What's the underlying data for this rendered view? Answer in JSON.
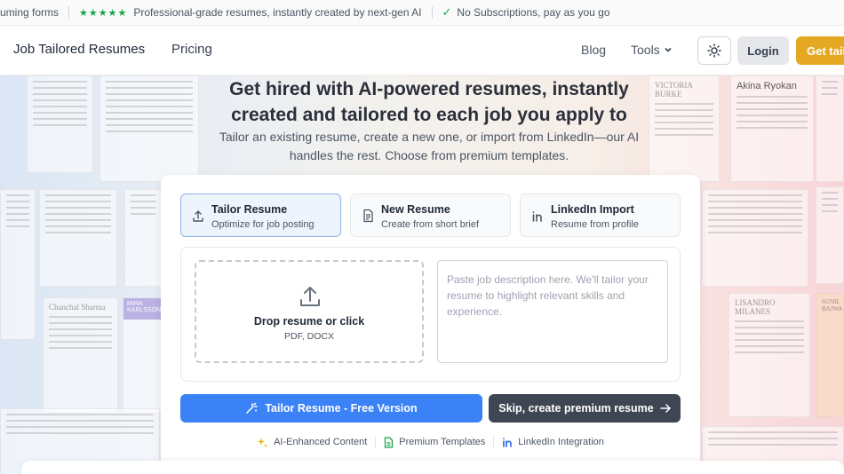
{
  "ticker": {
    "item1": "uming forms",
    "stars": "★★★★★",
    "item2": "Professional-grade resumes, instantly created by next-gen AI",
    "item3": "No Subscriptions, pay as you go"
  },
  "nav": {
    "brand": "Job Tailored Resumes",
    "pricing": "Pricing",
    "blog": "Blog",
    "tools": "Tools",
    "login": "Login",
    "get_started": "Get tail"
  },
  "hero": {
    "title_line1": "Get hired with AI-powered resumes, instantly",
    "title_line2": "created and tailored to each job you apply to",
    "subtitle_line1": "Tailor an existing resume, create a new one, or import from LinkedIn—our AI",
    "subtitle_line2": "handles the rest. Choose from premium templates."
  },
  "background_docs": {
    "name1": "Chanchal Sharma",
    "name2": "MIRA KARLSSON",
    "name3": "Akina Ryokan",
    "name4": "VICTORIA BURKE",
    "name5": "LISANDRO MILANES",
    "name6": "SUNIL BAJWA"
  },
  "tabs": [
    {
      "title": "Tailor Resume",
      "subtitle": "Optimize for job posting"
    },
    {
      "title": "New Resume",
      "subtitle": "Create from short brief"
    },
    {
      "title": "LinkedIn Import",
      "subtitle": "Resume from profile"
    }
  ],
  "upload": {
    "label": "Drop resume or click",
    "formats": "PDF, DOCX"
  },
  "job_description": {
    "placeholder": "Paste job description here. We'll tailor your resume to highlight relevant skills and experience."
  },
  "actions": {
    "tailor": "Tailor Resume - Free Version",
    "skip": "Skip, create premium resume"
  },
  "features": [
    "AI-Enhanced Content",
    "Premium Templates",
    "LinkedIn Integration"
  ],
  "colors": {
    "primary_blue": "#3b82f6",
    "dark_button": "#3f4653",
    "accent_gold": "#e5a823",
    "check_green": "#16a34a"
  }
}
